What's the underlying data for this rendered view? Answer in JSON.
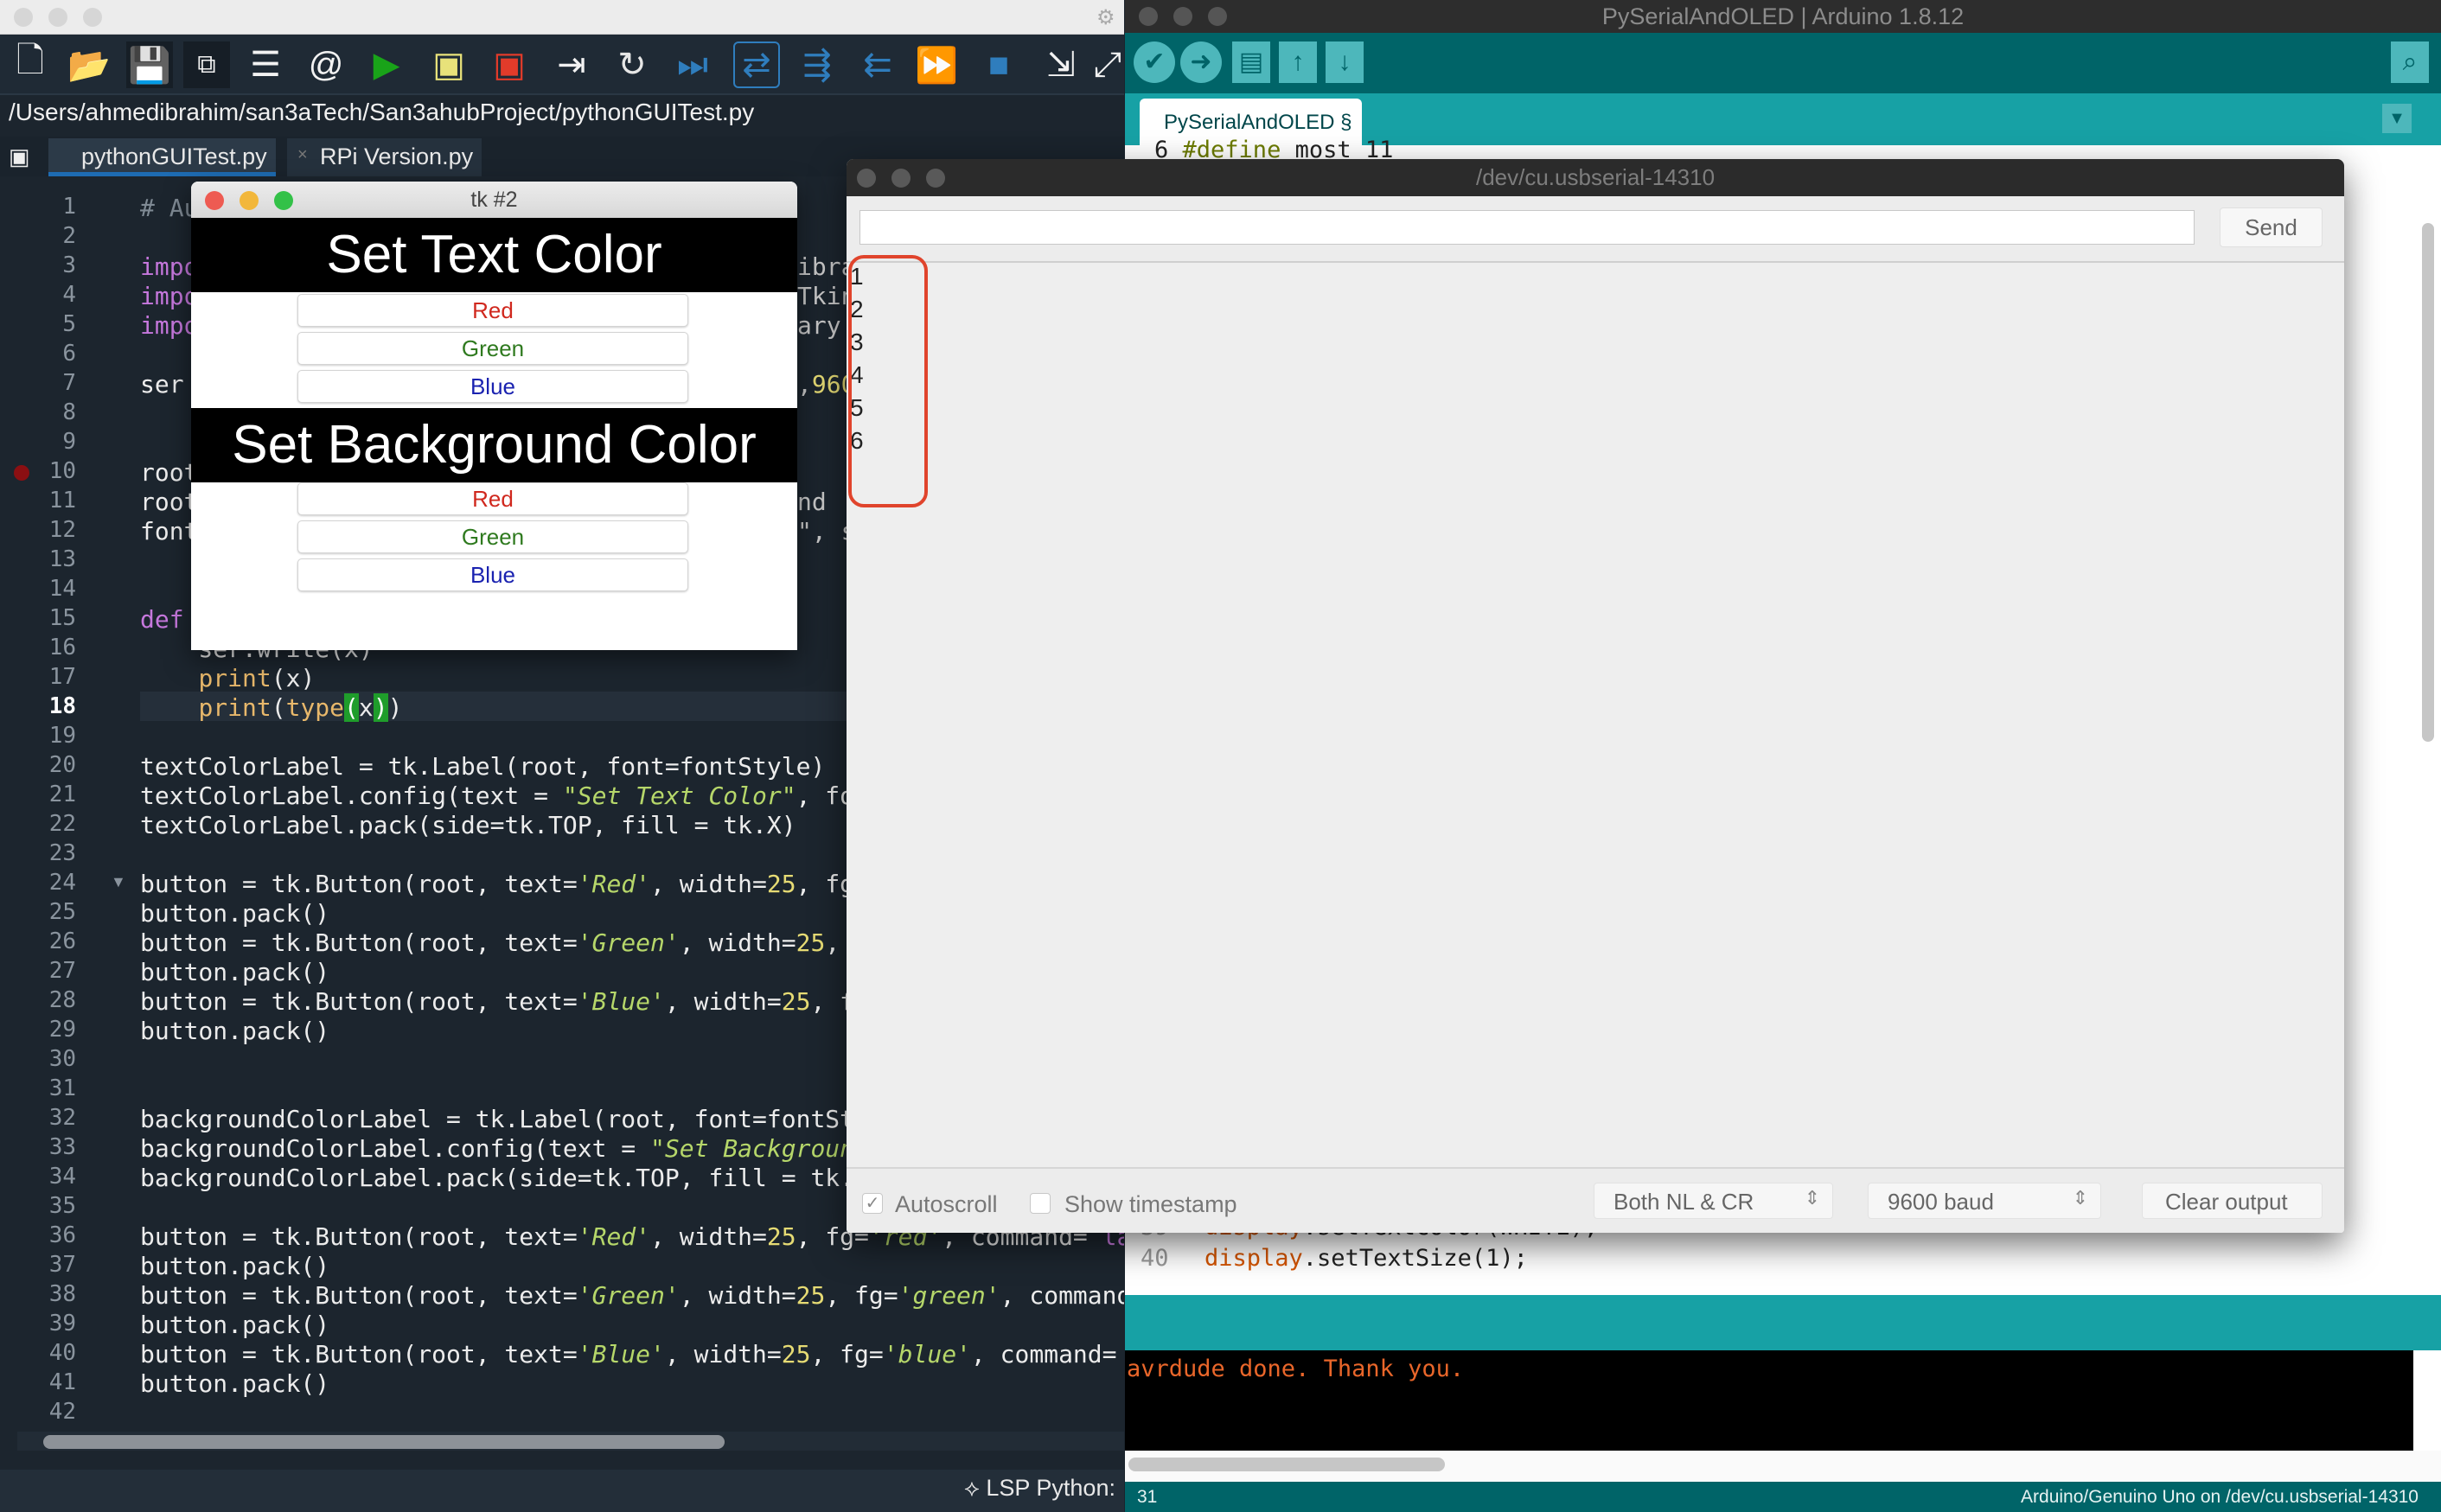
{
  "ide": {
    "path": "/Users/ahmedibrahim/san3aTech/San3ahubProject/pythonGUITest.py",
    "tabs": [
      {
        "label": "pythonGUITest.py",
        "active": true
      },
      {
        "label": "RPi Version.py",
        "active": false
      }
    ],
    "toolbar_icons": [
      "new-file-icon",
      "open-folder-icon",
      "save-icon",
      "save-all-icon",
      "list-icon",
      "at-sign-icon",
      "run-icon",
      "run-file-icon",
      "stop-run-icon",
      "step-icon",
      "reload-icon",
      "step-over-icon",
      "toggle-icon",
      "indent-icon",
      "outdent-icon",
      "fast-forward-icon",
      "stop-icon",
      "export-icon",
      "expand-icon"
    ],
    "current_line": 18,
    "breakpoint_line": 10,
    "code_lines": [
      {
        "n": 1,
        "tokens": [
          [
            "# Au",
            "c"
          ]
        ]
      },
      {
        "n": 2,
        "tokens": []
      },
      {
        "n": 3,
        "tokens": [
          [
            "impo",
            "k"
          ]
        ],
        "right": [
          [
            "ibra",
            "p"
          ]
        ]
      },
      {
        "n": 4,
        "tokens": [
          [
            "impo",
            "k"
          ]
        ],
        "right": [
          [
            "Tkin",
            "p"
          ]
        ]
      },
      {
        "n": 5,
        "tokens": [
          [
            "impo",
            "k"
          ]
        ],
        "right": [
          [
            "ary ",
            "p"
          ]
        ]
      },
      {
        "n": 6,
        "tokens": []
      },
      {
        "n": 7,
        "tokens": [
          [
            "ser",
            "p"
          ]
        ],
        "right": [
          [
            ",",
            "p"
          ],
          [
            "960",
            "n"
          ]
        ]
      },
      {
        "n": 8,
        "tokens": []
      },
      {
        "n": 9,
        "tokens": []
      },
      {
        "n": 10,
        "tokens": [
          [
            "root",
            "p"
          ]
        ]
      },
      {
        "n": 11,
        "tokens": [
          [
            "root",
            "p"
          ]
        ],
        "right": [
          [
            "nd ",
            "p"
          ]
        ]
      },
      {
        "n": 12,
        "tokens": [
          [
            "font",
            "p"
          ]
        ],
        "right": [
          [
            "\", s",
            "p"
          ]
        ]
      },
      {
        "n": 13,
        "tokens": []
      },
      {
        "n": 14,
        "tokens": []
      },
      {
        "n": 15,
        "tokens": [
          [
            "def",
            "k"
          ]
        ]
      },
      {
        "n": 16,
        "tokens": [
          [
            "    ser.write(x)",
            "p"
          ]
        ]
      },
      {
        "n": 17,
        "tokens": [
          [
            "    ",
            "p"
          ],
          [
            "print",
            "f"
          ],
          [
            "(x)",
            "p"
          ]
        ]
      },
      {
        "n": 18,
        "tokens": [
          [
            "    ",
            "p"
          ],
          [
            "print",
            "f"
          ],
          [
            "(",
            "p"
          ],
          [
            "type",
            "f"
          ],
          [
            "(",
            "h"
          ],
          [
            "x",
            "p"
          ],
          [
            ")",
            "h"
          ],
          [
            ")",
            "p"
          ]
        ]
      },
      {
        "n": 19,
        "tokens": []
      },
      {
        "n": 20,
        "tokens": [
          [
            "textColorLabel = tk.Label(root, font=fontStyle)",
            "p"
          ]
        ]
      },
      {
        "n": 21,
        "tokens": [
          [
            "textColorLabel.config(text = ",
            "p"
          ],
          [
            "\"Set Text Color\"",
            "s"
          ],
          [
            ", font",
            "p"
          ]
        ]
      },
      {
        "n": 22,
        "tokens": [
          [
            "textColorLabel.pack(side=tk.TOP, fill = tk.X)",
            "p"
          ]
        ]
      },
      {
        "n": 23,
        "tokens": []
      },
      {
        "n": 24,
        "fold": true,
        "tokens": [
          [
            "button = tk.Button(root, text=",
            "p"
          ],
          [
            "'Red'",
            "s"
          ],
          [
            ", width=",
            "p"
          ],
          [
            "25",
            "n"
          ],
          [
            ", fg",
            "p"
          ]
        ]
      },
      {
        "n": 25,
        "tokens": [
          [
            "button.pack()",
            "p"
          ]
        ]
      },
      {
        "n": 26,
        "tokens": [
          [
            "button = tk.Button(root, text=",
            "p"
          ],
          [
            "'Green'",
            "s"
          ],
          [
            ", width=",
            "p"
          ],
          [
            "25",
            "n"
          ],
          [
            ", ",
            "p"
          ]
        ]
      },
      {
        "n": 27,
        "tokens": [
          [
            "button.pack()",
            "p"
          ]
        ]
      },
      {
        "n": 28,
        "tokens": [
          [
            "button = tk.Button(root, text=",
            "p"
          ],
          [
            "'Blue'",
            "s"
          ],
          [
            ", width=",
            "p"
          ],
          [
            "25",
            "n"
          ],
          [
            ", f",
            "p"
          ]
        ]
      },
      {
        "n": 29,
        "tokens": [
          [
            "button.pack()",
            "p"
          ]
        ]
      },
      {
        "n": 30,
        "tokens": []
      },
      {
        "n": 31,
        "tokens": []
      },
      {
        "n": 32,
        "tokens": [
          [
            "backgroundColorLabel = tk.Label(root, font=fontSt",
            "p"
          ]
        ]
      },
      {
        "n": 33,
        "tokens": [
          [
            "backgroundColorLabel.config(text = ",
            "p"
          ],
          [
            "\"Set Backgroun",
            "s"
          ]
        ]
      },
      {
        "n": 34,
        "tokens": [
          [
            "backgroundColorLabel.pack(side=tk.TOP, fill = tk.",
            "p"
          ]
        ]
      },
      {
        "n": 35,
        "tokens": []
      },
      {
        "n": 36,
        "tokens": [
          [
            "button = tk.Button(root, text=",
            "p"
          ],
          [
            "'Red'",
            "s"
          ],
          [
            ", width=",
            "p"
          ],
          [
            "25",
            "n"
          ],
          [
            ", fg=",
            "p"
          ],
          [
            "'red'",
            "s"
          ],
          [
            ", command= ",
            "p"
          ],
          [
            "la",
            "k"
          ]
        ]
      },
      {
        "n": 37,
        "tokens": [
          [
            "button.pack()",
            "p"
          ]
        ]
      },
      {
        "n": 38,
        "tokens": [
          [
            "button = tk.Button(root, text=",
            "p"
          ],
          [
            "'Green'",
            "s"
          ],
          [
            ", width=",
            "p"
          ],
          [
            "25",
            "n"
          ],
          [
            ", fg=",
            "p"
          ],
          [
            "'green'",
            "s"
          ],
          [
            ", command",
            "p"
          ]
        ]
      },
      {
        "n": 39,
        "tokens": [
          [
            "button.pack()",
            "p"
          ]
        ]
      },
      {
        "n": 40,
        "tokens": [
          [
            "button = tk.Button(root, text=",
            "p"
          ],
          [
            "'Blue'",
            "s"
          ],
          [
            ", width=",
            "p"
          ],
          [
            "25",
            "n"
          ],
          [
            ", fg=",
            "p"
          ],
          [
            "'blue'",
            "s"
          ],
          [
            ", command=",
            "p"
          ]
        ]
      },
      {
        "n": 41,
        "tokens": [
          [
            "button.pack()",
            "p"
          ]
        ]
      },
      {
        "n": 42,
        "tokens": []
      }
    ],
    "status": "LSP Python:"
  },
  "tk": {
    "title": "tk #2",
    "text_header": "Set Text Color",
    "bg_header": "Set Background Color",
    "text_buttons": [
      {
        "label": "Red",
        "color": "#d0281e"
      },
      {
        "label": "Green",
        "color": "#2f7a1f"
      },
      {
        "label": "Blue",
        "color": "#1a22b0"
      }
    ],
    "bg_buttons": [
      {
        "label": "Red",
        "color": "#d0281e"
      },
      {
        "label": "Green",
        "color": "#2f7a1f"
      },
      {
        "label": "Blue",
        "color": "#1a22b0"
      }
    ]
  },
  "arduino": {
    "title": "PySerialAndOLED | Arduino 1.8.12",
    "tab": "PySerialAndOLED §",
    "peek_line": {
      "n": "6",
      "text_kw": "#define",
      "text": " most 11"
    },
    "lines": [
      {
        "n": "39",
        "obj": "display",
        "rest": ".setTextColor(WHITE);"
      },
      {
        "n": "40",
        "obj": "display",
        "rest": ".setTextSize(1);"
      }
    ],
    "console": "avrdude done.  Thank you.",
    "status_line": "31",
    "status_board": "Arduino/Genuino Uno on /dev/cu.usbserial-14310"
  },
  "serial": {
    "title": "/dev/cu.usbserial-14310",
    "input_value": "",
    "send": "Send",
    "output": [
      "1",
      "2",
      "3",
      "4",
      "5",
      "6"
    ],
    "autoscroll": {
      "label": "Autoscroll",
      "checked": true
    },
    "timestamp": {
      "label": "Show timestamp",
      "checked": false
    },
    "line_ending": "Both NL & CR",
    "baud": "9600 baud",
    "clear": "Clear output",
    "annotation_color": "#e0442c"
  }
}
